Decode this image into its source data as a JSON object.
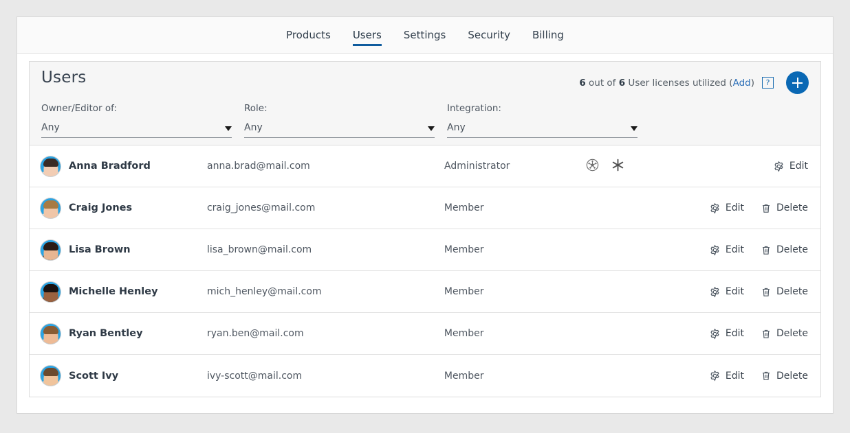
{
  "tabs": [
    {
      "label": "Products",
      "active": false
    },
    {
      "label": "Users",
      "active": true
    },
    {
      "label": "Settings",
      "active": false
    },
    {
      "label": "Security",
      "active": false
    },
    {
      "label": "Billing",
      "active": false
    }
  ],
  "card": {
    "title": "Users",
    "license": {
      "used": "6",
      "middle": " out of ",
      "total": "6",
      "suffix": " User licenses utilized (",
      "add_link": "Add",
      "close_paren": ")"
    },
    "help_icon_label": "?",
    "add_button_label": "+"
  },
  "filters": [
    {
      "label": "Owner/Editor of:",
      "value": "Any",
      "name": "owner-editor-filter"
    },
    {
      "label": "Role:",
      "value": "Any",
      "name": "role-filter"
    },
    {
      "label": "Integration:",
      "value": "Any",
      "name": "integration-filter"
    }
  ],
  "users": [
    {
      "name": "Anna Bradford",
      "email": "anna.brad@mail.com",
      "role": "Administrator",
      "integrations": [
        "kubernetes-icon",
        "snowflake-icon"
      ],
      "actions": [
        "Edit"
      ],
      "avatar": {
        "skin": "#f2cdb4",
        "hair": "#3a2b25",
        "shirt": "#e8e2dc",
        "ring": "#29a3e3"
      }
    },
    {
      "name": "Craig Jones",
      "email": "craig_jones@mail.com",
      "role": "Member",
      "integrations": [],
      "actions": [
        "Edit",
        "Delete"
      ],
      "avatar": {
        "skin": "#f0c6a8",
        "hair": "#a87b44",
        "shirt": "#dfe6ec",
        "ring": "#29a3e3"
      }
    },
    {
      "name": "Lisa Brown",
      "email": "lisa_brown@mail.com",
      "role": "Member",
      "integrations": [],
      "actions": [
        "Edit",
        "Delete"
      ],
      "avatar": {
        "skin": "#e8b692",
        "hair": "#2a1c16",
        "shirt": "#2b2b2b",
        "ring": "#29a3e3"
      }
    },
    {
      "name": "Michelle Henley",
      "email": "mich_henley@mail.com",
      "role": "Member",
      "integrations": [],
      "actions": [
        "Edit",
        "Delete"
      ],
      "avatar": {
        "skin": "#9a6240",
        "hair": "#1a1210",
        "shirt": "#3b3b3b",
        "ring": "#29a3e3"
      }
    },
    {
      "name": "Ryan Bentley",
      "email": "ryan.ben@mail.com",
      "role": "Member",
      "integrations": [],
      "actions": [
        "Edit",
        "Delete"
      ],
      "avatar": {
        "skin": "#eebb96",
        "hair": "#8a5c33",
        "shirt": "#d8d2cc",
        "ring": "#29a3e3"
      }
    },
    {
      "name": "Scott Ivy",
      "email": "ivy-scott@mail.com",
      "role": "Member",
      "integrations": [],
      "actions": [
        "Edit",
        "Delete"
      ],
      "avatar": {
        "skin": "#f0c49c",
        "hair": "#6b4a2e",
        "shirt": "#cfd8df",
        "ring": "#29a3e3"
      }
    }
  ],
  "action_labels": {
    "edit": "Edit",
    "delete": "Delete"
  },
  "colors": {
    "accent": "#0a68b4",
    "tab_underline": "#0f5c9e",
    "link": "#2c6fb8",
    "page_background": "#e9e9e9",
    "header_background": "#f6f6f6"
  }
}
